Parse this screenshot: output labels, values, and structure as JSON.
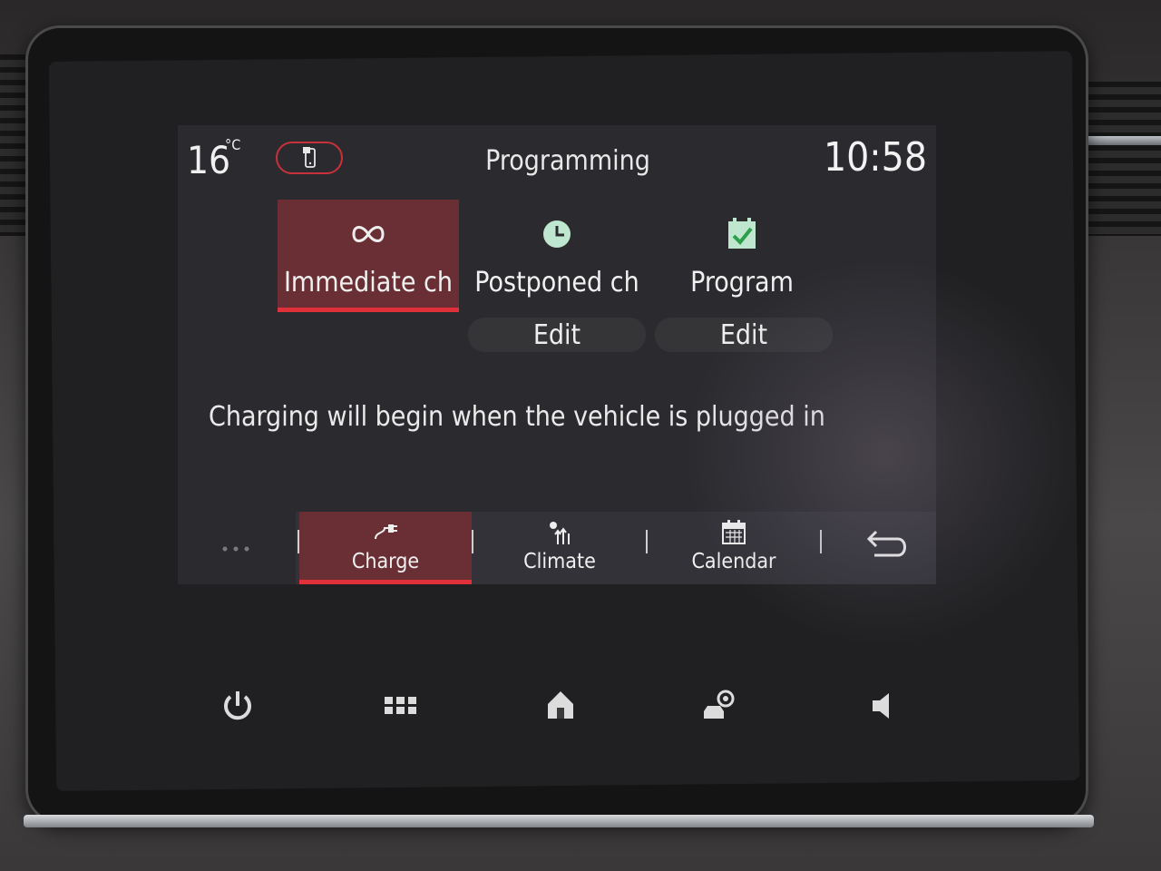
{
  "status": {
    "temperature": "16",
    "temperature_unit": "°C",
    "title": "Programming",
    "time": "10:58",
    "phone_icon": "phone-connection-icon"
  },
  "modes": [
    {
      "label": "Immediate ch",
      "icon": "infinity-icon",
      "selected": true
    },
    {
      "label": "Postponed ch",
      "icon": "clock-icon",
      "selected": false,
      "edit_label": "Edit"
    },
    {
      "label": "Program",
      "icon": "calendar-check-icon",
      "selected": false,
      "edit_label": "Edit"
    }
  ],
  "message": "Charging will begin when the vehicle is plugged in",
  "tabs": [
    {
      "label": "Charge",
      "icon": "plug-icon",
      "selected": true
    },
    {
      "label": "Climate",
      "icon": "climate-icon",
      "selected": false
    },
    {
      "label": "Calendar",
      "icon": "calendar-icon",
      "selected": false
    }
  ],
  "back_icon": "back-arrow-icon",
  "hardware_buttons": [
    "power-icon",
    "apps-grid-icon",
    "home-icon",
    "car-settings-icon",
    "volume-icon"
  ],
  "colors": {
    "accent": "#e0313a",
    "selected_bg": "#6a2f34",
    "screen_bg": "#2b2b2f",
    "icon_mint": "#bfe6cf"
  }
}
